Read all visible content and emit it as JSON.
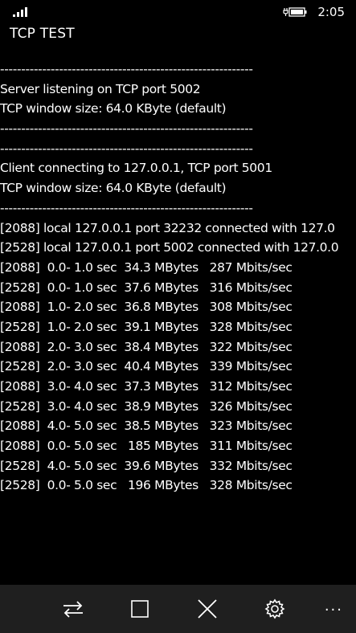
{
  "status_bar": {
    "time": "2:05",
    "icons": [
      "signal-icon",
      "battery-icon"
    ]
  },
  "app": {
    "title": "TCP TEST"
  },
  "console": {
    "lines": [
      "------------------------------------------------------------",
      "Server listening on TCP port 5002",
      "TCP window size: 64.0 KByte (default)",
      "------------------------------------------------------------",
      "------------------------------------------------------------",
      "Client connecting to 127.0.0.1, TCP port 5001",
      "TCP window size: 64.0 KByte (default)",
      "------------------------------------------------------------",
      "[2088] local 127.0.0.1 port 32232 connected with 127.0",
      "[2528] local 127.0.0.1 port 5002 connected with 127.0.0",
      "[2088]  0.0- 1.0 sec  34.3 MBytes   287 Mbits/sec",
      "[2528]  0.0- 1.0 sec  37.6 MBytes   316 Mbits/sec",
      "[2088]  1.0- 2.0 sec  36.8 MBytes   308 Mbits/sec",
      "[2528]  1.0- 2.0 sec  39.1 MBytes   328 Mbits/sec",
      "[2088]  2.0- 3.0 sec  38.4 MBytes   322 Mbits/sec",
      "[2528]  2.0- 3.0 sec  40.4 MBytes   339 Mbits/sec",
      "[2088]  3.0- 4.0 sec  37.3 MBytes   312 Mbits/sec",
      "[2528]  3.0- 4.0 sec  38.9 MBytes   326 Mbits/sec",
      "[2088]  4.0- 5.0 sec  38.5 MBytes   323 Mbits/sec",
      "[2088]  0.0- 5.0 sec   185 MBytes   311 Mbits/sec",
      "[2528]  4.0- 5.0 sec  39.6 MBytes   332 Mbits/sec",
      "[2528]  0.0- 5.0 sec   196 MBytes   328 Mbits/sec"
    ]
  },
  "app_bar": {
    "buttons": [
      "swap-icon",
      "stop-icon",
      "close-icon",
      "settings-icon"
    ],
    "more": "..."
  },
  "colors": {
    "background": "#000000",
    "text": "#ffffff",
    "app_bar": "#1f1f1f"
  }
}
